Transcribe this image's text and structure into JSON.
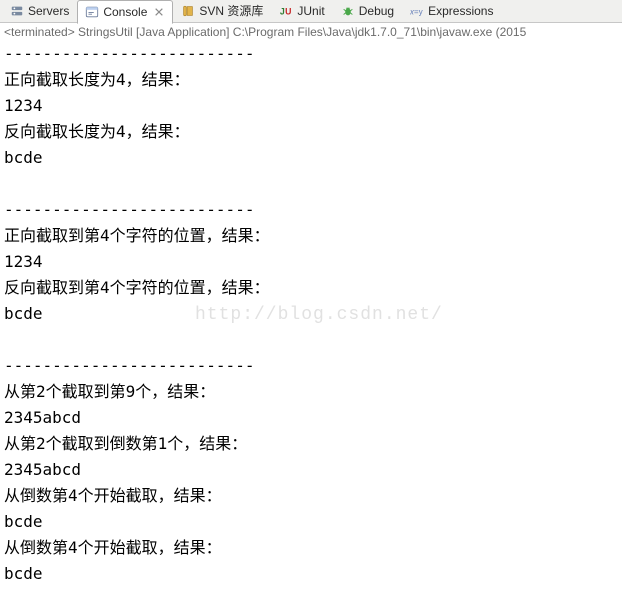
{
  "tabs": {
    "servers": {
      "label": "Servers"
    },
    "console": {
      "label": "Console"
    },
    "svn": {
      "label": "SVN 资源库"
    },
    "junit": {
      "label": "JUnit"
    },
    "debug": {
      "label": "Debug"
    },
    "expressions": {
      "label": "Expressions"
    }
  },
  "terminated_line": "<terminated> StringsUtil [Java Application] C:\\Program Files\\Java\\jdk1.7.0_71\\bin\\javaw.exe (2015",
  "output_lines": [
    "--------------------------",
    "正向截取长度为4，结果：",
    "1234",
    "反向截取长度为4，结果：",
    "bcde",
    "",
    "--------------------------",
    "正向截取到第4个字符的位置，结果：",
    "1234",
    "反向截取到第4个字符的位置，结果：",
    "bcde",
    "",
    "--------------------------",
    "从第2个截取到第9个，结果：",
    "2345abcd",
    "从第2个截取到倒数第1个，结果：",
    "2345abcd",
    "从倒数第4个开始截取，结果：",
    "bcde",
    "从倒数第4个开始截取，结果：",
    "bcde"
  ],
  "watermark": "http://blog.csdn.net/"
}
